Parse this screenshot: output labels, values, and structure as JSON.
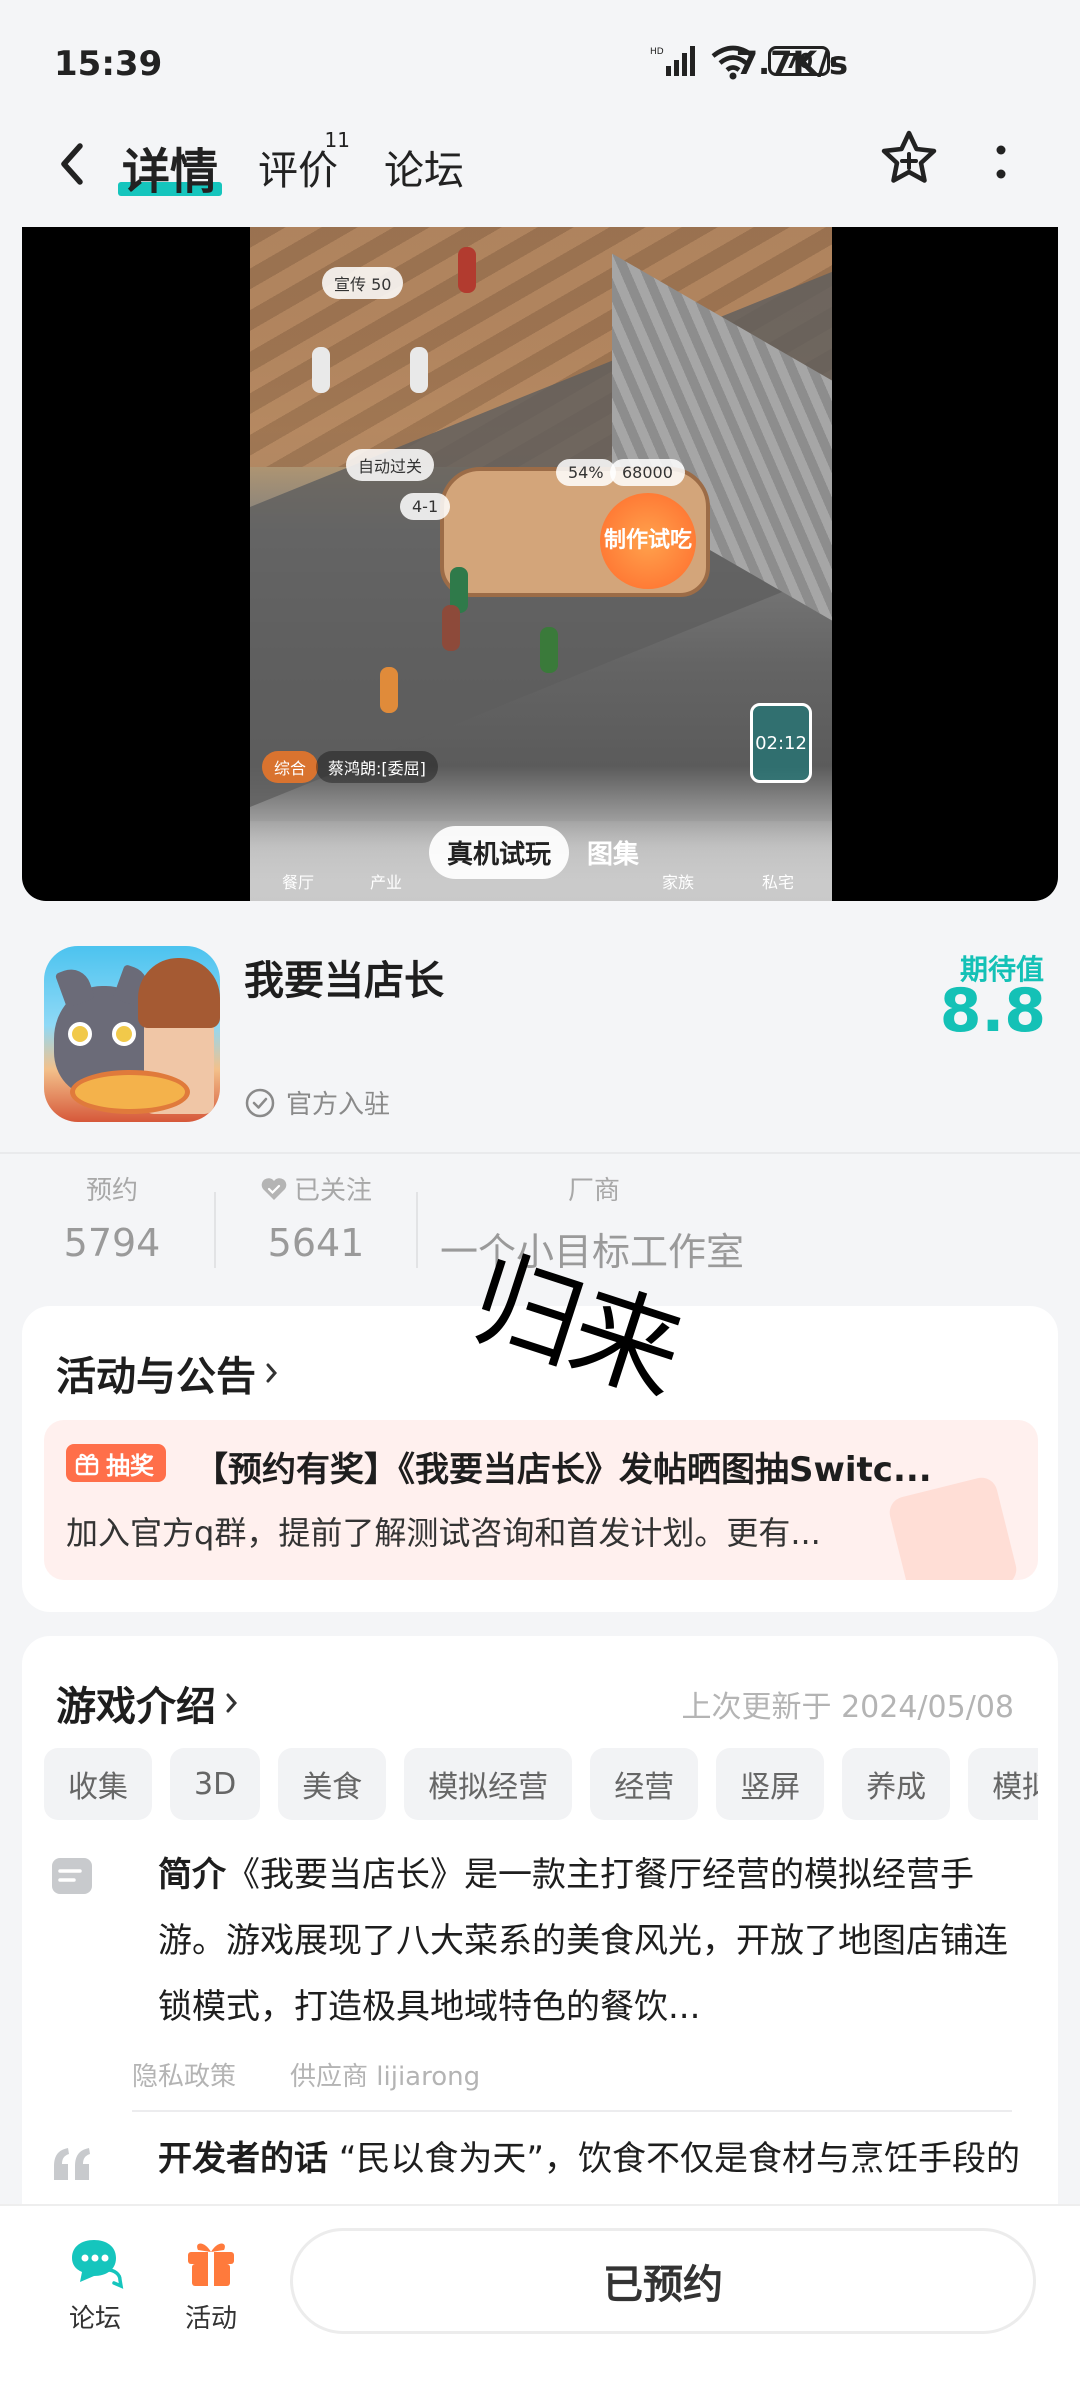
{
  "status_bar": {
    "time": "15:39",
    "network_speed": "7.7K/s",
    "battery_level": "70"
  },
  "nav": {
    "tabs": [
      {
        "label": "详情",
        "active": true
      },
      {
        "label": "评价",
        "badge": "11"
      },
      {
        "label": "论坛"
      }
    ],
    "icons": [
      "back-icon",
      "star-add-icon",
      "more-icon"
    ]
  },
  "media": {
    "tabs": [
      {
        "label": "真机试玩",
        "active": true
      },
      {
        "label": "图集"
      }
    ],
    "video_overlay": {
      "promo_chip": "宣传 50",
      "auto_chip": "自动过关",
      "level_chip": "4-1",
      "coin_chip": "68000",
      "percent_chip": "54%",
      "badge": "制作试吃",
      "timer": "02:12",
      "chat_chip": "综合",
      "chat_text": "蔡鸿朗:[委屈]",
      "toolbar_items": [
        "餐厅",
        "产业",
        "家族",
        "私宅"
      ]
    }
  },
  "game": {
    "name": "我要当店长",
    "official_label": "官方入驻",
    "expect_label": "期待值",
    "expect_value": "8.8"
  },
  "stats": [
    {
      "label": "预约",
      "value": "5794"
    },
    {
      "label": "已关注",
      "value": "5641"
    },
    {
      "label": "厂商",
      "value": "一个小目标工作室"
    }
  ],
  "watermark": "归来",
  "activity": {
    "title": "活动与公告",
    "badge": "抽奖",
    "notice_title": "【预约有奖】《我要当店长》发帖晒图抽Switc...",
    "notice_desc": "加入官方q群，提前了解测试咨询和首发计划。更有..."
  },
  "intro": {
    "title": "游戏介绍",
    "updated": "上次更新于 2024/05/08",
    "tags": [
      "收集",
      "3D",
      "美食",
      "模拟经营",
      "经营",
      "竖屏",
      "养成",
      "模拟"
    ],
    "summary_label": "简介",
    "summary_text": "《我要当店长》是一款主打餐厅经营的模拟经营手游。游戏展现了八大菜系的美食风光，开放了地图店铺连锁模式，打造极具地域特色的餐饮...",
    "privacy_link": "隐私政策",
    "supplier_link": "供应商 lijiarong",
    "dev_label": "开发者的话",
    "dev_text": "“民以食为天”，饮食不仅是食材与烹饪手段的碰撞，更是一种精神传承，记录着当地的"
  },
  "bottom_bar": {
    "forum_label": "论坛",
    "activity_label": "活动",
    "reserve_label": "已预约"
  },
  "colors": {
    "accent": "#15c5bd",
    "lottery": "#ff6f4a",
    "background": "#f4f5f7"
  }
}
